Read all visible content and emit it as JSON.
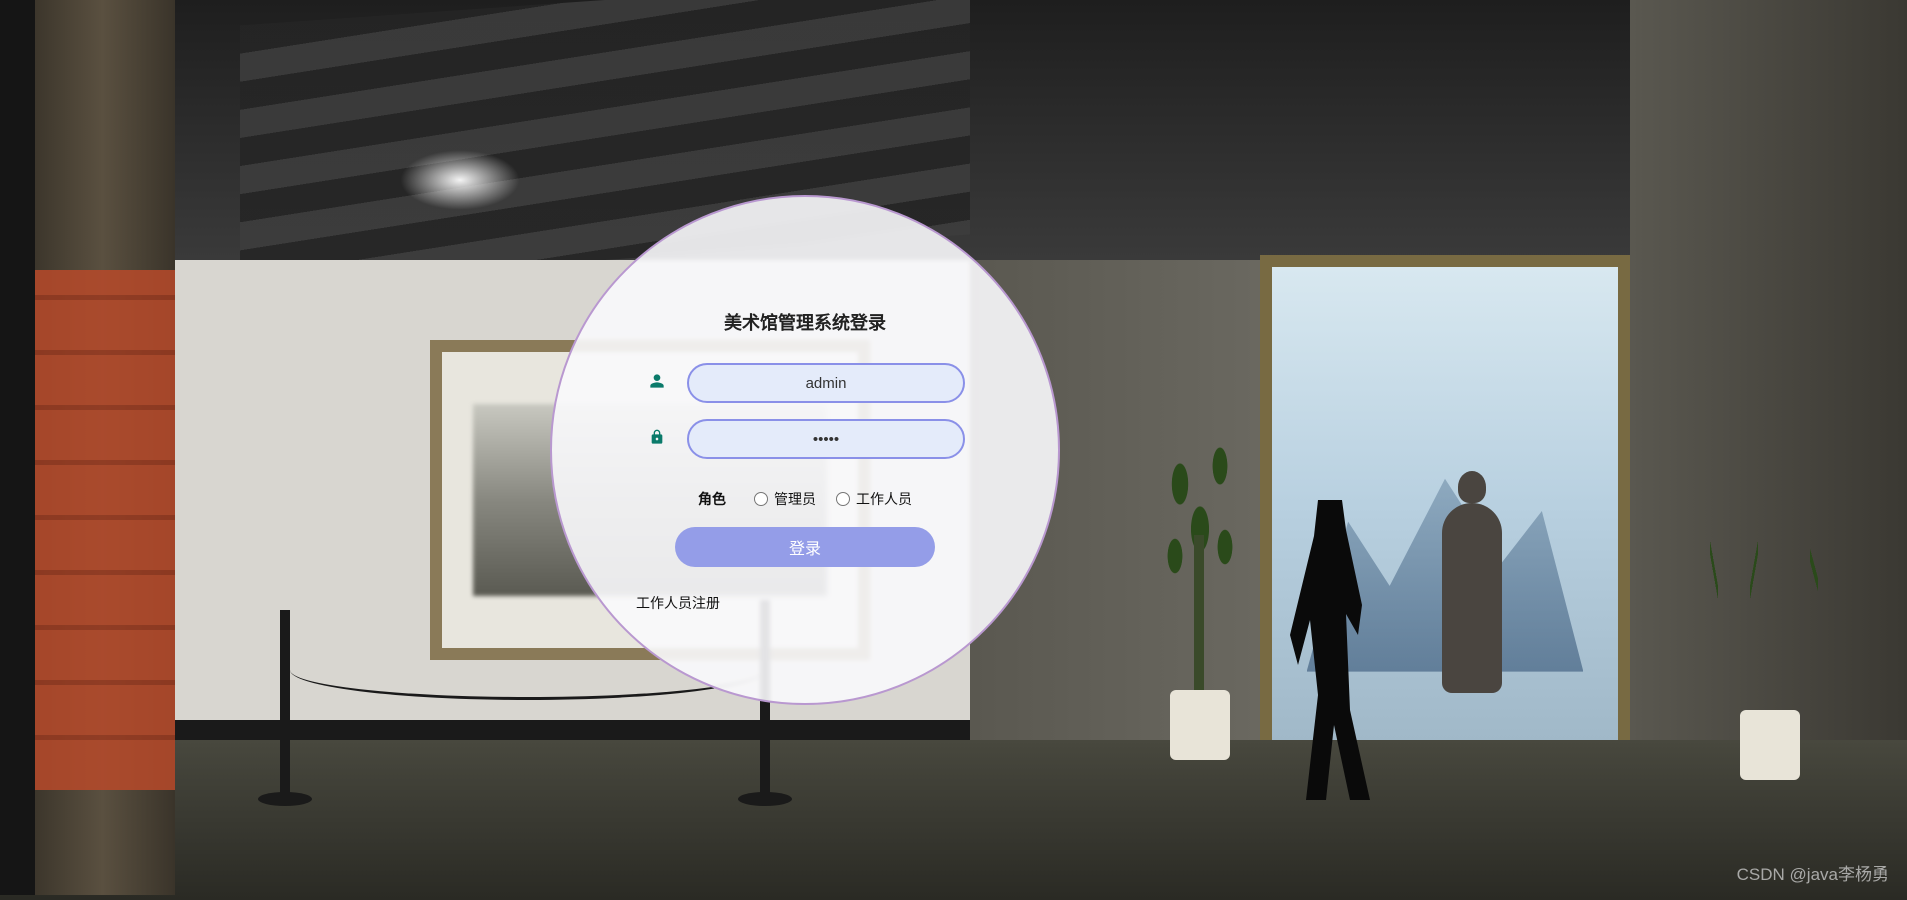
{
  "login": {
    "title": "美术馆管理系统登录",
    "username_value": "admin",
    "password_value": "•••••",
    "role_label": "角色",
    "role_options": {
      "admin": "管理员",
      "staff": "工作人员"
    },
    "submit_label": "登录",
    "register_link": "工作人员注册",
    "icons": {
      "user": "user-icon",
      "lock": "lock-icon"
    },
    "colors": {
      "circle_border": "#b998d0",
      "input_border": "#8a90e8",
      "input_bg": "#e4ebfa",
      "button_bg": "#949de8",
      "icon_color": "#0a7a6a"
    }
  },
  "watermark": "CSDN @java李杨勇"
}
